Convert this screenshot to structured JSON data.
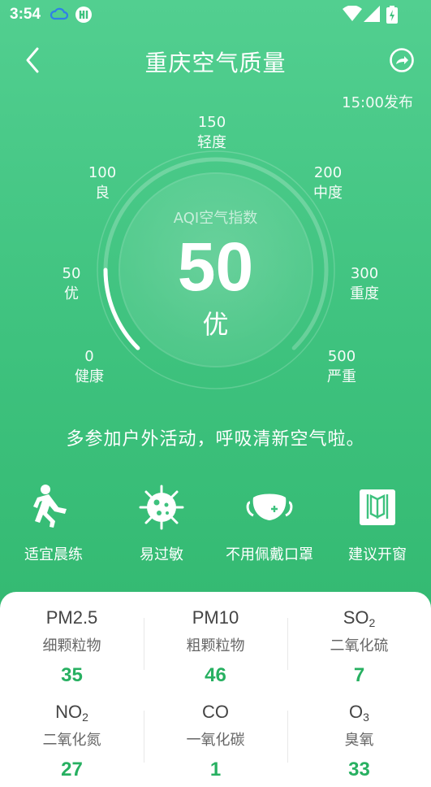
{
  "status_bar": {
    "time": "3:54"
  },
  "header": {
    "title": "重庆空气质量"
  },
  "publish_time": "15:00发布",
  "gauge": {
    "ticks": [
      {
        "value": "0",
        "label": "健康"
      },
      {
        "value": "50",
        "label": "优"
      },
      {
        "value": "100",
        "label": "良"
      },
      {
        "value": "150",
        "label": "轻度"
      },
      {
        "value": "200",
        "label": "中度"
      },
      {
        "value": "300",
        "label": "重度"
      },
      {
        "value": "500",
        "label": "严重"
      }
    ],
    "label": "AQI空气指数",
    "value": "50",
    "level": "优",
    "max": 500
  },
  "advice": "多参加户外活动，呼吸清新空气啦。",
  "tips": [
    {
      "label": "适宜晨练",
      "icon": "running-person-icon"
    },
    {
      "label": "易过敏",
      "icon": "virus-icon"
    },
    {
      "label": "不用佩戴口罩",
      "icon": "mask-icon"
    },
    {
      "label": "建议开窗",
      "icon": "window-icon"
    }
  ],
  "pollutants": [
    {
      "name": "PM2.5",
      "sub": "",
      "cn": "细颗粒物",
      "value": "35"
    },
    {
      "name": "PM10",
      "sub": "",
      "cn": "粗颗粒物",
      "value": "46"
    },
    {
      "name": "SO",
      "sub": "2",
      "cn": "二氧化硫",
      "value": "7"
    },
    {
      "name": "NO",
      "sub": "2",
      "cn": "二氧化氮",
      "value": "27"
    },
    {
      "name": "CO",
      "sub": "",
      "cn": "一氧化碳",
      "value": "1"
    },
    {
      "name": "O",
      "sub": "3",
      "cn": "臭氧",
      "value": "33"
    }
  ],
  "colors": {
    "accent": "#27b061",
    "bg_top": "#52cf90",
    "bg_bottom": "#2eb56b"
  }
}
